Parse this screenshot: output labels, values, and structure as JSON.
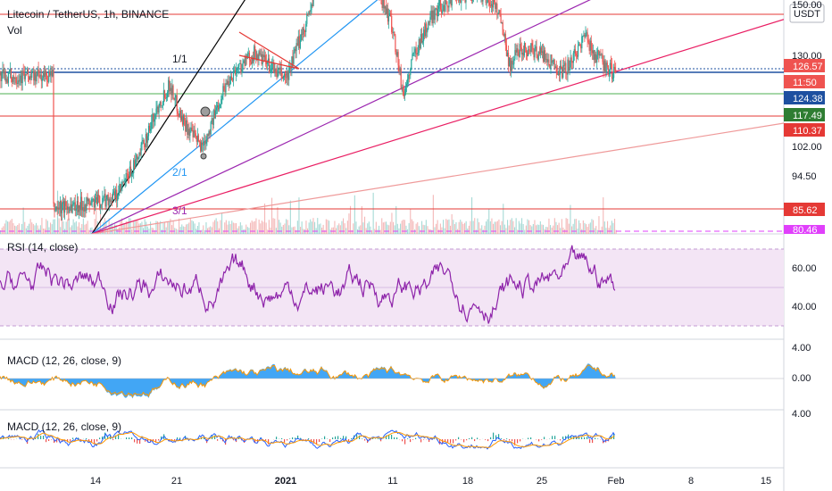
{
  "header": {
    "symbol_line": "Litecoin / TetherUS, 1h, BINANCE",
    "volume_label": "Vol",
    "currency_button": "USDT"
  },
  "colors": {
    "up": "#26a69a",
    "down": "#ef5350",
    "hline_red": "#e53935",
    "hline_blue": "#1e50a0",
    "hline_green": "#4caf50",
    "fan_black": "#000000",
    "fan_blue": "#2196f3",
    "fan_purple": "#9c27b0",
    "fan_pink": "#e91e63",
    "fan_salmon": "#ef9a9a",
    "rsi_line": "#8e24aa",
    "rsi_band": "#f3e5f5",
    "macd_fill": "#2196f3",
    "macd_line": "#2962ff",
    "signal_line": "#ff9800"
  },
  "fan_labels": [
    "1/1",
    "2/1",
    "3/1"
  ],
  "price_axis": {
    "ticks": [
      "150.00",
      "130.00",
      "102.00",
      "94.50"
    ],
    "badges": [
      {
        "text": "126.57",
        "color": "#ef5350"
      },
      {
        "text": "11:50",
        "color": "#ef5350"
      },
      {
        "text": "124.38",
        "color": "#1e50a0"
      },
      {
        "text": "117.49",
        "color": "#2e7d32"
      },
      {
        "text": "110.37",
        "color": "#e53935"
      },
      {
        "text": "85.62",
        "color": "#e53935"
      },
      {
        "text": "80.46",
        "color": "#e040fb"
      }
    ]
  },
  "rsi": {
    "title": "RSI (14, close)",
    "ticks": [
      "60.00",
      "40.00"
    ]
  },
  "macd1": {
    "title": "MACD (12, 26, close, 9)",
    "ticks": [
      "4.00",
      "0.00"
    ]
  },
  "macd2": {
    "title": "MACD (12, 26, close, 9)",
    "ticks": [
      "4.00"
    ]
  },
  "time_axis": {
    "labels": [
      "14",
      "21",
      "2021",
      "11",
      "18",
      "25",
      "Feb",
      "8",
      "15"
    ]
  },
  "chart_data": {
    "type": "candlestick",
    "symbol": "Litecoin / TetherUS",
    "interval": "1h",
    "exchange": "BINANCE",
    "x_range": [
      "Dec 10",
      "Feb 18"
    ],
    "data_end": "Feb 1",
    "price_range": [
      80,
      155
    ],
    "price_path": [
      [
        "Dec 10",
        84
      ],
      [
        "Dec 14",
        86
      ],
      [
        "Dec 16",
        88
      ],
      [
        "Dec 18",
        100
      ],
      [
        "Dec 20",
        118
      ],
      [
        "Dec 21",
        124
      ],
      [
        "Dec 22",
        114
      ],
      [
        "Dec 23",
        108
      ],
      [
        "Dec 24",
        104
      ],
      [
        "Dec 25",
        112
      ],
      [
        "Dec 26",
        122
      ],
      [
        "Dec 27",
        128
      ],
      [
        "Dec 29",
        134
      ],
      [
        "Dec 31",
        128
      ],
      [
        "Jan 1",
        126
      ],
      [
        "Jan 2",
        136
      ],
      [
        "Jan 4",
        156
      ],
      [
        "Jan 6",
        162
      ],
      [
        "Jan 9",
        160
      ],
      [
        "Jan 11",
        142
      ],
      [
        "Jan 12",
        120
      ],
      [
        "Jan 13",
        134
      ],
      [
        "Jan 15",
        148
      ],
      [
        "Jan 17",
        152
      ],
      [
        "Jan 19",
        154
      ],
      [
        "Jan 21",
        148
      ],
      [
        "Jan 22",
        130
      ],
      [
        "Jan 23",
        136
      ],
      [
        "Jan 25",
        134
      ],
      [
        "Jan 27",
        128
      ],
      [
        "Jan 28",
        132
      ],
      [
        "Jan 29",
        140
      ],
      [
        "Jan 30",
        134
      ],
      [
        "Jan 31",
        130
      ],
      [
        "Feb 1",
        126.57
      ]
    ],
    "horizontal_levels": [
      {
        "price": 142,
        "color": "red"
      },
      {
        "price": 124.38,
        "color": "blue"
      },
      {
        "price": 117.49,
        "color": "green"
      },
      {
        "price": 110.37,
        "color": "red"
      },
      {
        "price": 85.62,
        "color": "red"
      },
      {
        "price": 80.46,
        "color": "magenta",
        "style": "dashed"
      }
    ],
    "gann_fan": {
      "origin": "Dec 14",
      "labels": [
        "1/1",
        "2/1",
        "3/1"
      ]
    },
    "rsi": {
      "period": 14,
      "range_shown": [
        25,
        75
      ],
      "bands": [
        30,
        70
      ],
      "ticks": [
        60,
        40
      ]
    },
    "macd": {
      "fast": 12,
      "slow": 26,
      "signal": 9,
      "ticks": [
        4,
        0
      ]
    }
  }
}
